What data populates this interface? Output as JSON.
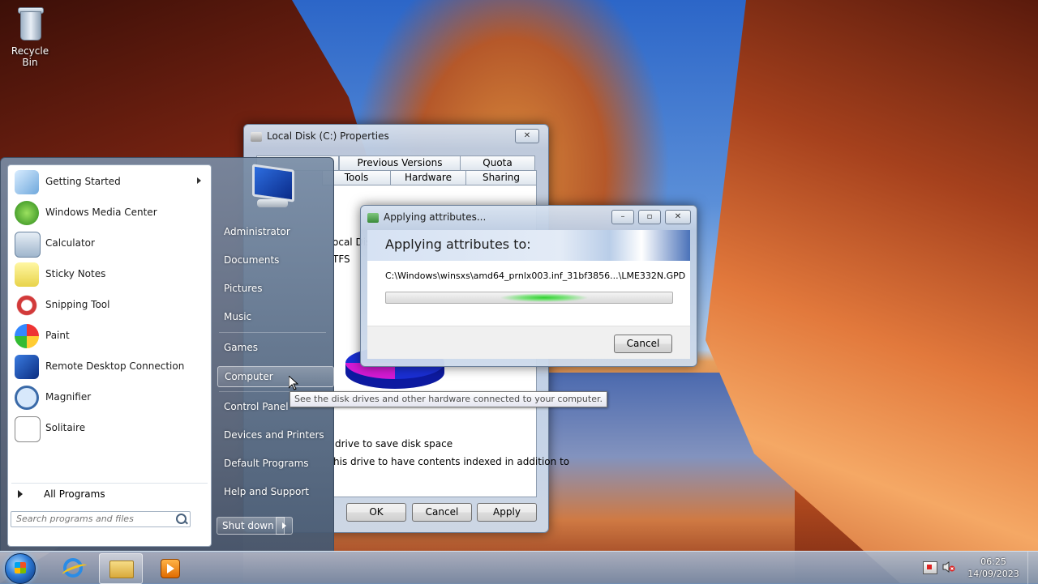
{
  "desktop": {
    "icons": [
      {
        "label": "Recycle Bin",
        "icon": "recycle-bin-icon"
      }
    ]
  },
  "properties_window": {
    "title": "Local Disk (C:) Properties",
    "tabs_row1": [
      "Previous Versions",
      "Quota"
    ],
    "tabs_row2": [
      "Tools",
      "Hardware",
      "Sharing"
    ],
    "partial_texts": [
      "ocal Dis",
      "TFS",
      "drive to save disk space",
      "his drive to have contents indexed in addition to"
    ],
    "buttons": {
      "ok": "OK",
      "cancel": "Cancel",
      "apply": "Apply"
    },
    "pie_colors": {
      "used": "#1a2fd4",
      "free": "#d41ad4"
    }
  },
  "apply_dialog": {
    "title": "Applying attributes...",
    "heading": "Applying attributes to:",
    "path": "C:\\Windows\\winsxs\\amd64_prnlx003.inf_31bf3856...\\LME332N.GPD",
    "progress": 0.5,
    "cancel": "Cancel"
  },
  "start_menu": {
    "programs": [
      {
        "label": "Getting Started",
        "icon": "getting-started-icon",
        "submenu": true
      },
      {
        "label": "Windows Media Center",
        "icon": "media-center-icon"
      },
      {
        "label": "Calculator",
        "icon": "calculator-icon"
      },
      {
        "label": "Sticky Notes",
        "icon": "sticky-notes-icon"
      },
      {
        "label": "Snipping Tool",
        "icon": "snipping-tool-icon"
      },
      {
        "label": "Paint",
        "icon": "paint-icon"
      },
      {
        "label": "Remote Desktop Connection",
        "icon": "remote-desktop-icon"
      },
      {
        "label": "Magnifier",
        "icon": "magnifier-icon"
      },
      {
        "label": "Solitaire",
        "icon": "solitaire-icon"
      }
    ],
    "all_programs": "All Programs",
    "search_placeholder": "Search programs and files",
    "right_items": [
      "Administrator",
      "Documents",
      "Pictures",
      "Music",
      "Games",
      "Computer",
      "Control Panel",
      "Devices and Printers",
      "Default Programs",
      "Help and Support"
    ],
    "shutdown": "Shut down",
    "tooltip": "See the disk drives and other hardware connected to your computer."
  },
  "taskbar": {
    "pinned": [
      "internet-explorer-icon",
      "windows-explorer-icon",
      "media-player-icon"
    ],
    "tray_icons": [
      "action-center-flag-icon",
      "volume-muted-icon"
    ],
    "time": "06:25",
    "date": "14/09/2023"
  }
}
